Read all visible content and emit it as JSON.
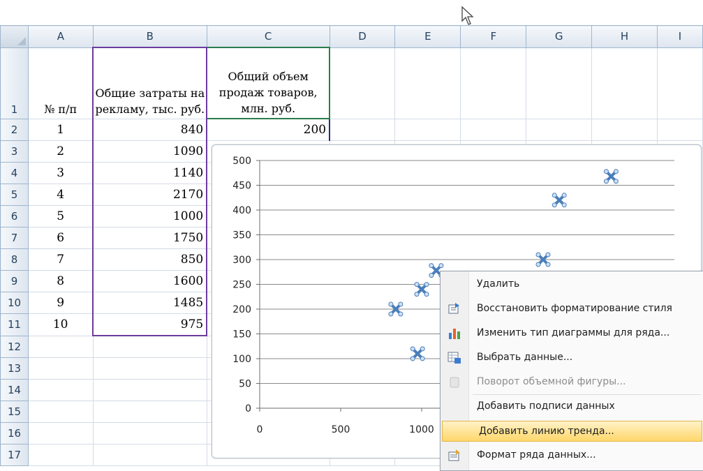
{
  "columns": [
    "A",
    "B",
    "C",
    "D",
    "E",
    "F",
    "G",
    "H",
    "I"
  ],
  "rows": [
    "1",
    "2",
    "3",
    "4",
    "5",
    "6",
    "7",
    "8",
    "9",
    "10",
    "11",
    "12",
    "13",
    "14",
    "15",
    "16",
    "17"
  ],
  "header_cells": {
    "a1": "№ п/п",
    "b1": "Общие затраты на рекламу, тыс. руб.",
    "c1": "Общий объем продаж товаров, млн. руб."
  },
  "data_rows": [
    {
      "n": "1",
      "cost": "840",
      "sales": "200"
    },
    {
      "n": "2",
      "cost": "1090",
      "sales": ""
    },
    {
      "n": "3",
      "cost": "1140",
      "sales": ""
    },
    {
      "n": "4",
      "cost": "2170",
      "sales": ""
    },
    {
      "n": "5",
      "cost": "1000",
      "sales": ""
    },
    {
      "n": "6",
      "cost": "1750",
      "sales": ""
    },
    {
      "n": "7",
      "cost": "850",
      "sales": ""
    },
    {
      "n": "8",
      "cost": "1600",
      "sales": ""
    },
    {
      "n": "9",
      "cost": "1485",
      "sales": ""
    },
    {
      "n": "10",
      "cost": "975",
      "sales": ""
    }
  ],
  "chart_data": {
    "type": "scatter",
    "xlim": [
      0,
      2500
    ],
    "ylim": [
      0,
      500
    ],
    "x_ticks": [
      "0",
      "500",
      "1000"
    ],
    "y_ticks": [
      "0",
      "50",
      "100",
      "150",
      "200",
      "250",
      "300",
      "350",
      "400",
      "450",
      "500"
    ],
    "x": [
      840,
      975,
      1000,
      1090,
      1750,
      1850,
      2170
    ],
    "y": [
      200,
      110,
      240,
      278,
      300,
      420,
      468
    ],
    "marker_color": "#4a7ebb",
    "grid": "horizontal"
  },
  "context_menu": {
    "items": [
      {
        "label": "Удалить",
        "icon": "none",
        "disabled": false
      },
      {
        "label": "Восстановить форматирование стиля",
        "icon": "reset-style-icon",
        "disabled": false
      },
      {
        "label": "Изменить тип диаграммы для ряда...",
        "icon": "chart-type-icon",
        "disabled": false
      },
      {
        "label": "Выбрать данные...",
        "icon": "select-data-icon",
        "disabled": false
      },
      {
        "label": "Поворот объемной фигуры...",
        "icon": "3d-rotation-icon",
        "disabled": true
      },
      {
        "label": "Добавить подписи данных",
        "icon": "none",
        "disabled": false
      },
      {
        "label": "Добавить линию тренда...",
        "icon": "none",
        "disabled": false
      },
      {
        "label": "Формат ряда данных...",
        "icon": "format-series-icon",
        "disabled": false
      }
    ],
    "highlighted_index": 6,
    "highlight_color": "#ffd76a"
  }
}
